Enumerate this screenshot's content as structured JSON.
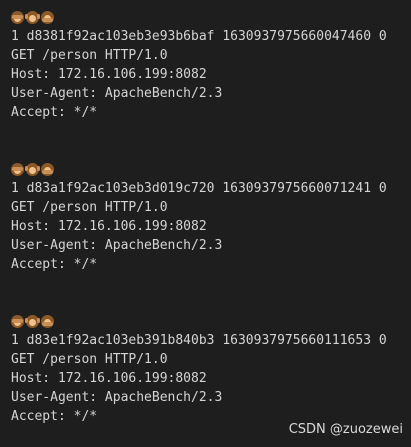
{
  "requests": [
    {
      "icons": [
        "see-no-evil-monkey",
        "hear-no-evil-monkey",
        "speak-no-evil-monkey"
      ],
      "lines": [
        "1 d8381f92ac103eb3e93b6baf 1630937975660047460 0",
        "GET /person HTTP/1.0",
        "Host: 172.16.106.199:8082",
        "User-Agent: ApacheBench/2.3",
        "Accept: */*"
      ]
    },
    {
      "icons": [
        "see-no-evil-monkey",
        "hear-no-evil-monkey",
        "speak-no-evil-monkey"
      ],
      "lines": [
        "1 d83a1f92ac103eb3d019c720 1630937975660071241 0",
        "GET /person HTTP/1.0",
        "Host: 172.16.106.199:8082",
        "User-Agent: ApacheBench/2.3",
        "Accept: */*"
      ]
    },
    {
      "icons": [
        "see-no-evil-monkey",
        "hear-no-evil-monkey",
        "speak-no-evil-monkey"
      ],
      "lines": [
        "1 d83e1f92ac103eb391b840b3 1630937975660111653 0",
        "GET /person HTTP/1.0",
        "Host: 172.16.106.199:8082",
        "User-Agent: ApacheBench/2.3",
        "Accept: */*"
      ]
    }
  ],
  "watermark": "CSDN @zuozewei",
  "colors": {
    "background": "#1e1e1e",
    "text": "#d4d4d4"
  }
}
